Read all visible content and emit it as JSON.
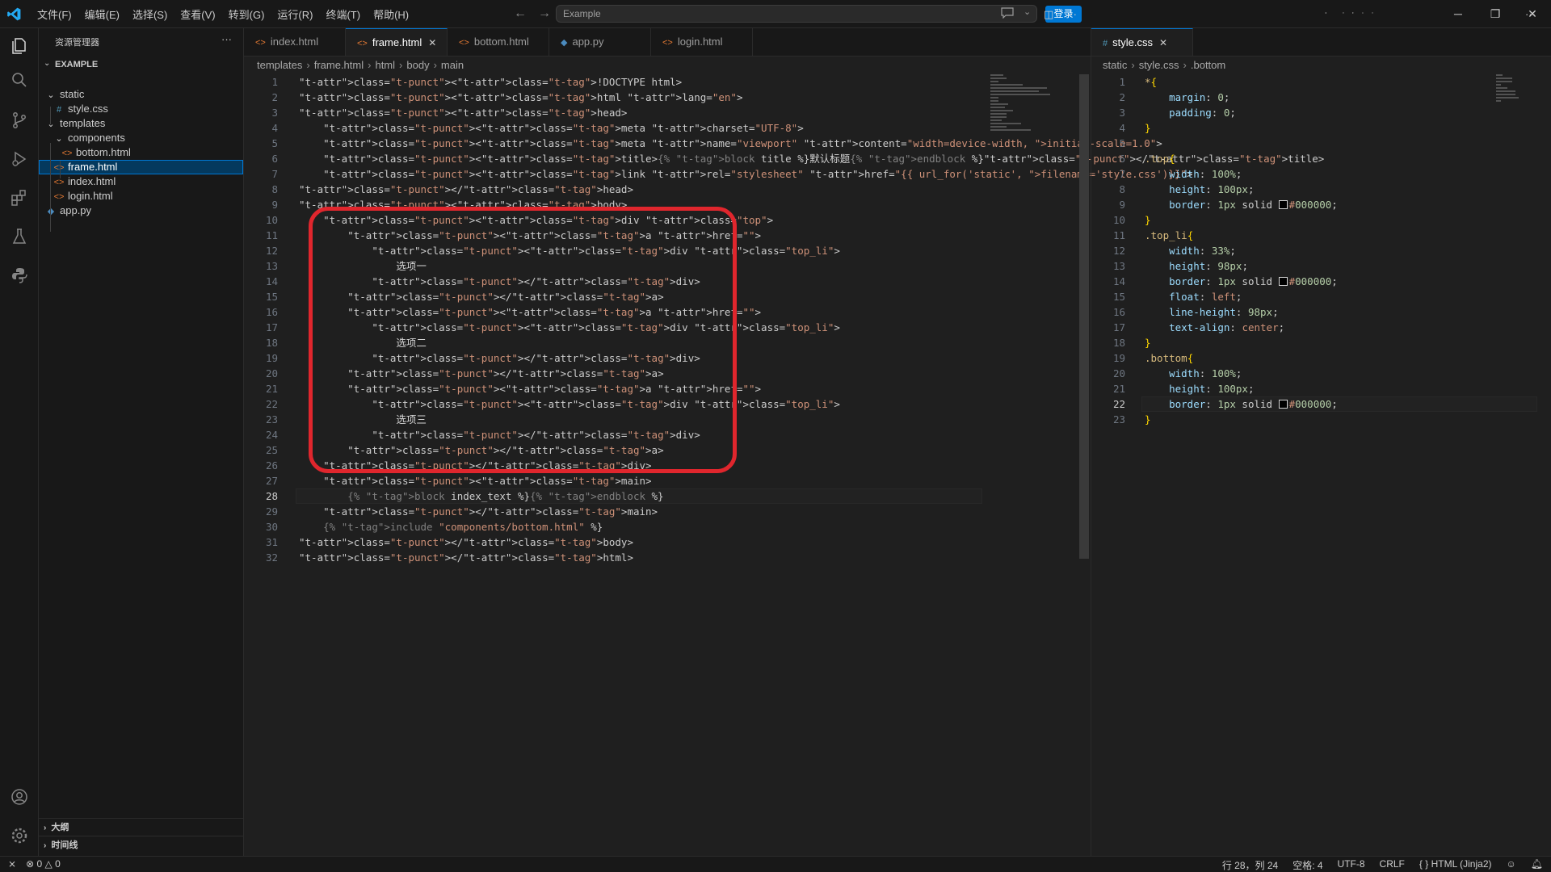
{
  "menu": [
    "文件(F)",
    "编辑(E)",
    "选择(S)",
    "查看(V)",
    "转到(G)",
    "运行(R)",
    "终端(T)",
    "帮助(H)"
  ],
  "command_center": "Example",
  "login_button": "登录",
  "sidebar": {
    "title": "资源管理器",
    "section": "EXAMPLE",
    "tree": [
      {
        "label": "static",
        "type": "folder",
        "depth": 0
      },
      {
        "label": "style.css",
        "type": "css",
        "depth": 1
      },
      {
        "label": "templates",
        "type": "folder",
        "depth": 0
      },
      {
        "label": "components",
        "type": "folder",
        "depth": 1
      },
      {
        "label": "bottom.html",
        "type": "html",
        "depth": 2
      },
      {
        "label": "frame.html",
        "type": "html",
        "depth": 1,
        "selected": true
      },
      {
        "label": "index.html",
        "type": "html",
        "depth": 1
      },
      {
        "label": "login.html",
        "type": "html",
        "depth": 1
      },
      {
        "label": "app.py",
        "type": "py",
        "depth": 0
      }
    ],
    "outline": "大纲",
    "timeline": "时间线"
  },
  "left_tabs": [
    {
      "label": "index.html",
      "icon": "html-icon"
    },
    {
      "label": "frame.html",
      "icon": "html-icon",
      "active": true
    },
    {
      "label": "bottom.html",
      "icon": "html-icon"
    },
    {
      "label": "app.py",
      "icon": "python-icon"
    },
    {
      "label": "login.html",
      "icon": "html-icon"
    }
  ],
  "right_tabs": [
    {
      "label": "style.css",
      "icon": "css-icon",
      "active": true
    }
  ],
  "left_breadcrumb": [
    "templates",
    "frame.html",
    "html",
    "body",
    "main"
  ],
  "right_breadcrumb": [
    "static",
    "style.css",
    ".bottom"
  ],
  "left_code": [
    "<!DOCTYPE html>",
    "<html lang=\"en\">",
    "<head>",
    "    <meta charset=\"UTF-8\">",
    "    <meta name=\"viewport\" content=\"width=device-width, initial-scale=1.0\">",
    "    <title>{% block title %}默认标题{% endblock %}</title>",
    "    <link rel=\"stylesheet\" href=\"{{ url_for('static', filename='style.css')}}\">",
    "</head>",
    "<body>",
    "    <div class=\"top\">",
    "        <a href=\"\">",
    "            <div class=\"top_li\">",
    "                选项一",
    "            </div>",
    "        </a>",
    "        <a href=\"\">",
    "            <div class=\"top_li\">",
    "                选项二",
    "            </div>",
    "        </a>",
    "        <a href=\"\">",
    "            <div class=\"top_li\">",
    "                选项三",
    "            </div>",
    "        </a>",
    "    </div>",
    "    <main>",
    "        {% block index_text %}{% endblock %}",
    "    </main>",
    "    {% include \"components/bottom.html\" %}",
    "</body>",
    "</html>"
  ],
  "left_current_line": 28,
  "right_code": [
    "*{",
    "    margin: 0;",
    "    padding: 0;",
    "}",
    "",
    ".top{",
    "    width: 100%;",
    "    height: 100px;",
    "    border: 1px solid #000000;",
    "}",
    ".top_li{",
    "    width: 33%;",
    "    height: 98px;",
    "    border: 1px solid #000000;",
    "    float: left;",
    "    line-height: 98px;",
    "    text-align: center;",
    "}",
    ".bottom{",
    "    width: 100%;",
    "    height: 100px;",
    "    border: 1px solid #000000;",
    "}"
  ],
  "right_current_line": 22,
  "status": {
    "errors": "0",
    "warnings": "0",
    "position": "行 28，列 24",
    "spaces": "空格: 4",
    "encoding": "UTF-8",
    "eol": "CRLF",
    "language": "HTML (Jinja2)"
  },
  "colors": {
    "accent": "#0078d4",
    "highlight_box": "#e0262d",
    "background": "#1f1f1f"
  }
}
